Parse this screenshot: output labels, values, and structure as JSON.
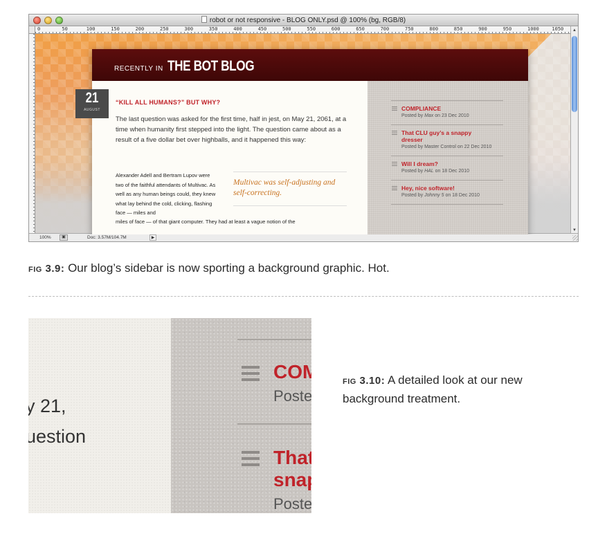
{
  "window": {
    "title": "robot or not responsive - BLOG ONLY.psd @ 100% (bg, RGB/8)",
    "ruler_ticks": [
      "0",
      "50",
      "100",
      "150",
      "200",
      "250",
      "300",
      "350",
      "400",
      "450",
      "500",
      "550",
      "600",
      "650",
      "700",
      "750",
      "800",
      "850",
      "900",
      "950",
      "1000",
      "1050"
    ],
    "status": {
      "zoom": "100%",
      "doc": "Doc: 3.57M/104.7M"
    }
  },
  "blog": {
    "header_small": "RECENTLY IN",
    "header_big": "THE BOT BLOG",
    "date": {
      "day": "21",
      "month": "AUGUST"
    },
    "post_title": "“KILL ALL HUMANS?” BUT WHY?",
    "paragraph1": "The last question was asked for the first time, half in jest, on May 21, 2061, at a time when humanity first stepped into the light. The question came about as a result of a five dollar bet over highballs, and it happened this way:",
    "paragraph2": "Alexander Adell and Bertram Lupov were two of the faithful attendants of Multivac. As well as any human beings could, they knew what lay behind the cold, clicking, flashing face — miles and",
    "paragraph2_cont": "miles of face — of that giant computer. They had at least a vague notion of the",
    "pull_quote": "Multivac was self-adjusting and self-correcting.",
    "sidebar": [
      {
        "title": "COMPLIANCE",
        "meta_pre": "Posted by ",
        "author": "Max",
        "meta_post": " on 23 Dec 2010"
      },
      {
        "title": "That CLU guy’s a snappy dresser",
        "meta_pre": "Posted by ",
        "author": "Master Control",
        "meta_post": " on 22 Dec 2010"
      },
      {
        "title": "Will I dream?",
        "meta_pre": "Posted by ",
        "author": "HAL",
        "meta_post": " on 18 Dec 2010"
      },
      {
        "title": "Hey, nice software!",
        "meta_pre": "Posted by ",
        "author": "Johnny 5",
        "meta_post": " on 18 Dec 2010"
      }
    ]
  },
  "fig1": {
    "label": "FIG 3.9:",
    "text": " Our blog’s sidebar is now sporting a background graphic. Hot."
  },
  "zoom": {
    "text1": "y 21,",
    "text2": "uestion",
    "item1_title": "COM",
    "item1_meta": "Poste",
    "item2_title_line1": "That",
    "item2_title_line2": "snap",
    "item2_meta": "Poste"
  },
  "fig2": {
    "label": "FIG 3.10:",
    "text": " A detailed look at our new background treatment."
  },
  "colors": {
    "accent_red": "#c0232a",
    "header_dark": "#4a0a0a",
    "pull_orange": "#c8721f"
  }
}
